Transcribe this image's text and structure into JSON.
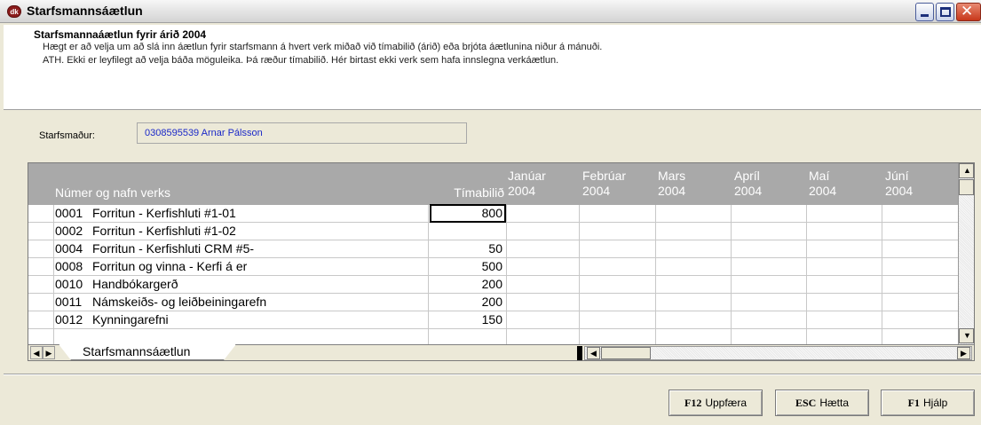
{
  "window": {
    "title": "Starfsmannsáætlun",
    "app_icon_text": "dk",
    "controls": {
      "minimize": "minimize",
      "maximize": "maximize",
      "close": "✕"
    }
  },
  "header": {
    "title": "Starfsmannaáætlun fyrir árið 2004",
    "line1": "Hægt er að velja um að slá inn áætlun fyrir starfsmann á hvert verk miðað við tímabilið (árið) eða brjóta áætlunina niður á mánuði.",
    "line2": "ATH.  Ekki er leyfilegt að velja báða möguleika.  Þá ræður tímabilið.  Hér birtast ekki verk sem hafa innslegna verkáætlun."
  },
  "employee": {
    "label": "Starfsmaður:",
    "value": "0308595539 Arnar Pálsson"
  },
  "grid": {
    "columns": {
      "name": "Númer og nafn verks",
      "period": "Tímabilið",
      "months": [
        {
          "month": "Janúar",
          "year": "2004"
        },
        {
          "month": "Febrúar",
          "year": "2004"
        },
        {
          "month": "Mars",
          "year": "2004"
        },
        {
          "month": "Apríl",
          "year": "2004"
        },
        {
          "month": "Maí",
          "year": "2004"
        },
        {
          "month": "Júní",
          "year": "2004"
        }
      ]
    },
    "rows": [
      {
        "num": "0001",
        "name": "Forritun - Kerfishluti #1-01",
        "period": "800"
      },
      {
        "num": "0002",
        "name": "Forritun - Kerfishluti #1-02",
        "period": ""
      },
      {
        "num": "0004",
        "name": "Forritun - Kerfishluti CRM #5-",
        "period": "50"
      },
      {
        "num": "0008",
        "name": "Forritun og vinna - Kerfi á er",
        "period": "500"
      },
      {
        "num": "0010",
        "name": "Handbókargerð",
        "period": "200"
      },
      {
        "num": "0011",
        "name": "Námskeiðs- og leiðbeiningarefn",
        "period": "200"
      },
      {
        "num": "0012",
        "name": "Kynningarefni",
        "period": "150"
      }
    ],
    "sheet_tab": "Starfsmannsáætlun"
  },
  "buttons": {
    "update": {
      "key": "F12",
      "label": "Uppfæra"
    },
    "quit": {
      "key": "ESC",
      "label": "Hætta"
    },
    "help": {
      "key": "F1",
      "label": "Hjálp"
    }
  }
}
